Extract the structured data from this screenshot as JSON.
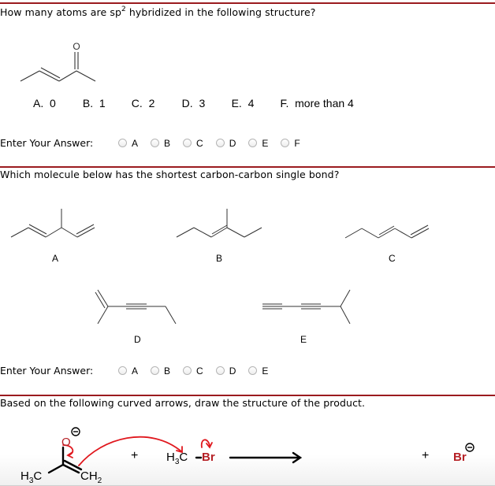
{
  "colors": {
    "rule": "#9b1b1f",
    "accent_red": "#b52025"
  },
  "question1": {
    "text_before": "How many atoms are sp",
    "superscript": "2",
    "text_after": " hybridized in the following structure?",
    "molecule": {
      "atom_label": "O"
    },
    "choices": [
      {
        "letter": "A.",
        "value": "0"
      },
      {
        "letter": "B.",
        "value": "1"
      },
      {
        "letter": "C.",
        "value": "2"
      },
      {
        "letter": "D.",
        "value": "3"
      },
      {
        "letter": "E.",
        "value": "4"
      },
      {
        "letter": "F.",
        "value": "more than 4"
      }
    ],
    "answer_label": "Enter Your Answer:",
    "options": [
      "A",
      "B",
      "C",
      "D",
      "E",
      "F"
    ]
  },
  "question2": {
    "text": "Which molecule below has the shortest carbon-carbon single bond?",
    "molecule_labels": [
      "A",
      "B",
      "C",
      "D",
      "E"
    ],
    "answer_label": "Enter Your Answer:",
    "options": [
      "A",
      "B",
      "C",
      "D",
      "E"
    ]
  },
  "question3": {
    "text": "Based on the following curved arrows, draw the structure of the product.",
    "reactant1": {
      "oxygen": "O",
      "charge": "⊖",
      "left_group": "H",
      "left_sub": "3",
      "left_tail": "C",
      "right_group": "CH",
      "right_sub": "2"
    },
    "plus1": "+",
    "reactant2": {
      "methyl": "H",
      "methyl_sub": "3",
      "methyl_tail": "C",
      "bond": "-",
      "halogen": "Br"
    },
    "plus2": "+",
    "byproduct": {
      "halogen": "Br",
      "charge": "⊖"
    }
  }
}
